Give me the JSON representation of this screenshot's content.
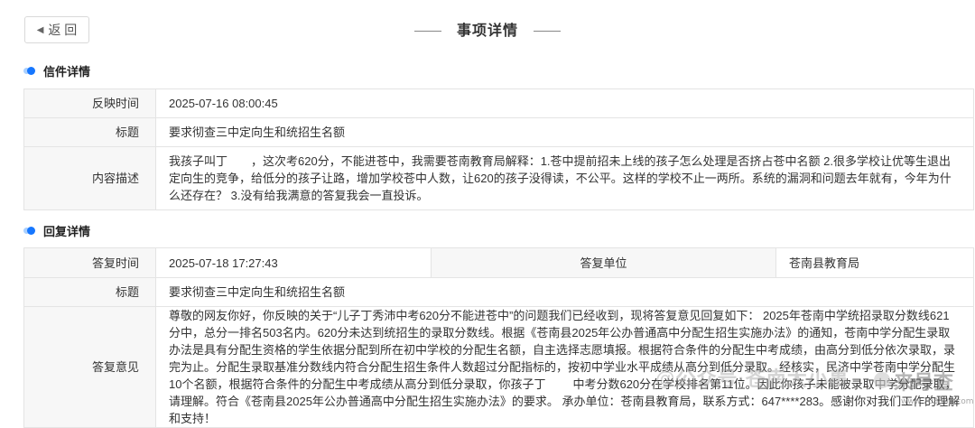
{
  "header": {
    "back_label": "返 回",
    "title": "事项详情"
  },
  "letter": {
    "section_title": "信件详情",
    "time_label": "反映时间",
    "time_value": "2025-07-16 08:00:45",
    "subject_label": "标题",
    "subject_value": "要求彻查三中定向生和统招生名额",
    "content_label": "内容描述",
    "content_p1": "我孩子叫丁",
    "content_p2": "，这次考620分，不能进苍中，我需要苍南教育局解释：1.苍中提前招未上线的孩子怎么处理是否挤占苍中名额 2.很多学校让优等生退出定向生的竞争，给低分的孩子让路，增加学校苍中人数，让620的孩子没得读，不公平。这样的学校不止一两所。系统的漏洞和问题去年就有，今年为什么还存在？ 3.没有给我满意的答复我会一直投诉。"
  },
  "reply": {
    "section_title": "回复详情",
    "time_label": "答复时间",
    "time_value": "2025-07-18 17:27:43",
    "unit_label": "答复单位",
    "unit_value": "苍南县教育局",
    "subject_label": "标题",
    "subject_value": "要求彻查三中定向生和统招生名额",
    "opinion_label": "答复意见",
    "opinion_p1": "尊敬的网友你好，你反映的关于“儿子丁秀沛中考620分不能进苍中”的问题我们已经收到，现将答复意见回复如下： 2025年苍南中学统招录取分数线621分中，总分一排名503名内。620分未达到统招生的录取分数线。根据《苍南县2025年公办普通高中分配生招生实施办法》的通知，苍南中学分配生录取办法是具有分配生资格的学生依据分配到所在初中学校的分配生名额，自主选择志愿填报。根据符合条件的分配生中考成绩，由高分到低分依次录取，录完为止。分配生录取基准分数线内符合分配生招生条件人数超过分配指标的，按初中学业水平成绩从高分到低分录取。经核实，民济中学苍南中学分配生10个名额，根据符合条件的分配生中考成绩从高分到低分录取，你孩子丁",
    "opinion_p2": "中考分数620分在学校排名第11位。因此你孩子未能被录取中学分配录取，请理解。符合《苍南县2025年公办普通高中分配生招生实施办法》的要求。 承办单位：苍南县教育局，联系方式：647****283。感谢你对我们工作的理解和支持！"
  },
  "watermark": {
    "text": "@公众号·苍南大小事",
    "brand": "来号查",
    "url": "www.703804.com"
  }
}
